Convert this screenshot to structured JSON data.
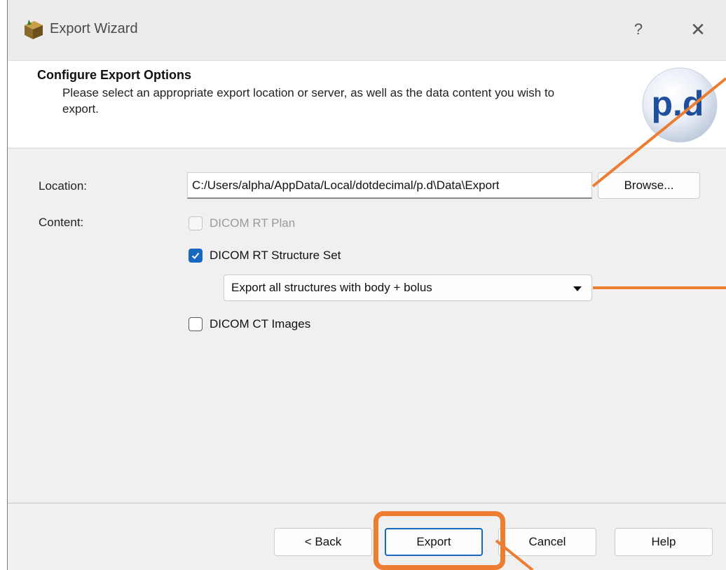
{
  "window": {
    "title": "Export Wizard",
    "help_label": "?",
    "close_label": "✕"
  },
  "banner": {
    "title": "Configure Export Options",
    "subtitle": "Please select an appropriate export location or server, as well as the data content you wish to export.",
    "logo_text": "p.d"
  },
  "form": {
    "location_label": "Location:",
    "location_value": "C:/Users/alpha/AppData/Local/dotdecimal/p.d\\Data\\Export",
    "browse_label": "Browse...",
    "content_label": "Content:",
    "options": [
      {
        "label": "DICOM RT Plan",
        "checked": false,
        "disabled": true
      },
      {
        "label": "DICOM RT Structure Set",
        "checked": true,
        "disabled": false
      },
      {
        "label": "DICOM CT Images",
        "checked": false,
        "disabled": false
      }
    ],
    "structure_select_value": "Export all structures with body + bolus"
  },
  "footer": {
    "back_label": "< Back",
    "export_label": "Export",
    "cancel_label": "Cancel",
    "help_label": "Help"
  },
  "colors": {
    "accent": "#1668c0",
    "annotation": "#ed7d31"
  }
}
